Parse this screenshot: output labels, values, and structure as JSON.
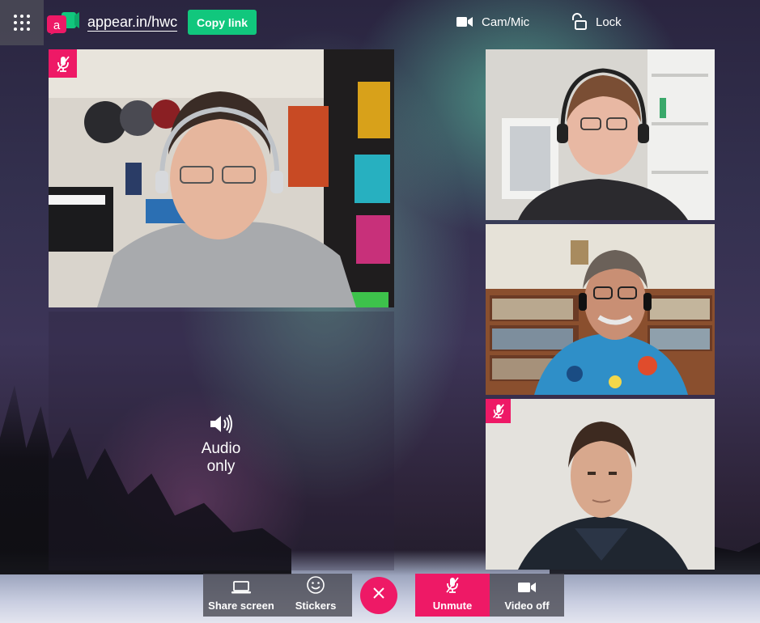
{
  "topbar": {
    "room_name": "appear.in/hwc",
    "copy_link_label": "Copy link",
    "cam_mic_label": "Cam/Mic",
    "lock_label": "Lock",
    "accent_green": "#11c77d",
    "brand_pink": "#ee1966"
  },
  "icons": [
    "apps-grid-icon",
    "appear-in-logo",
    "camera-icon",
    "lock-icon",
    "mic-muted-icon",
    "speaker-icon",
    "laptop-icon",
    "smiley-icon",
    "close-icon",
    "video-camera-icon"
  ],
  "tiles": [
    {
      "id": "main-participant",
      "muted": true
    },
    {
      "id": "audio-only",
      "label": "Audio\nonly"
    },
    {
      "id": "participant-2",
      "muted": false
    },
    {
      "id": "participant-3",
      "muted": false
    },
    {
      "id": "participant-4",
      "muted": true
    }
  ],
  "controls": {
    "share_screen": "Share screen",
    "stickers": "Stickers",
    "unmute": "Unmute",
    "video_off": "Video off"
  }
}
